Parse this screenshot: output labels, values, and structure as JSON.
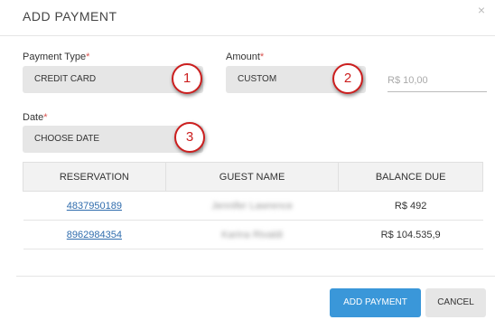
{
  "modal": {
    "title": "ADD PAYMENT",
    "close_glyph": "×"
  },
  "form": {
    "payment_type": {
      "label": "Payment Type",
      "required_mark": "*",
      "value": "CREDIT CARD"
    },
    "amount": {
      "label": "Amount",
      "required_mark": "*",
      "type_value": "CUSTOM",
      "input_placeholder": "R$ 10,00"
    },
    "date": {
      "label": "Date",
      "required_mark": "*",
      "value": "CHOOSE DATE"
    }
  },
  "callouts": [
    "1",
    "2",
    "3"
  ],
  "table": {
    "headers": [
      "RESERVATION",
      "GUEST NAME",
      "BALANCE DUE"
    ],
    "rows": [
      {
        "reservation": "4837950189",
        "guest_name": "Jennifer Lawrence",
        "balance_due": "R$ 492"
      },
      {
        "reservation": "8962984354",
        "guest_name": "Karina Rivaldi",
        "balance_due": "R$ 104.535,9"
      }
    ]
  },
  "footer": {
    "add_payment_label": "ADD PAYMENT",
    "cancel_label": "CANCEL"
  },
  "colors": {
    "primary": "#3a97d9",
    "callout_red": "#cc1f1f",
    "link": "#2f6cad"
  }
}
